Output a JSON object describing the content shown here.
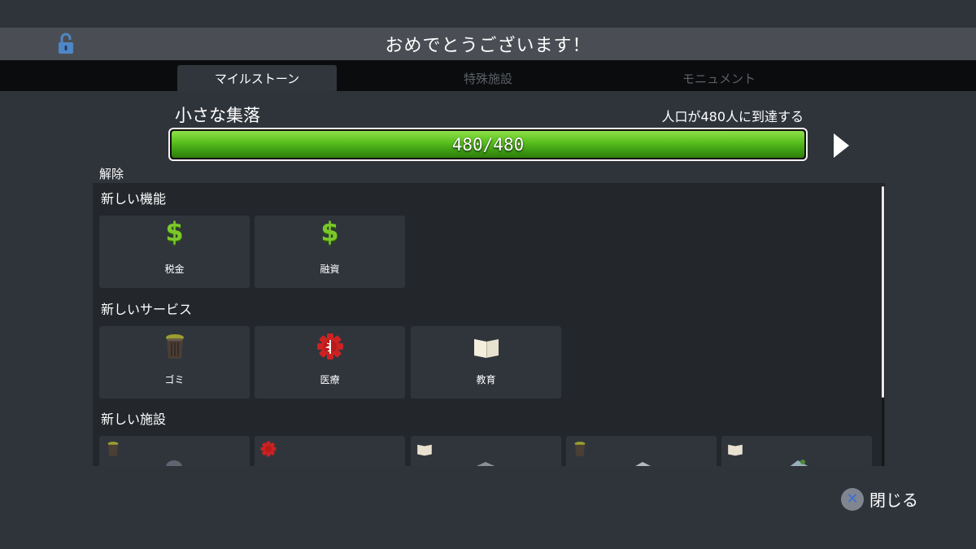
{
  "header": {
    "title": "おめでとうございます！",
    "lock_icon": "unlocked-padlock-icon"
  },
  "tabs": [
    {
      "label": "マイルストーン",
      "active": true
    },
    {
      "label": "特殊施設",
      "active": false
    },
    {
      "label": "モニュメント",
      "active": false
    }
  ],
  "milestone": {
    "name": "小さな集落",
    "goal": "人口が480人に到達する",
    "progress_text": "480/480",
    "progress_fraction": 1.0
  },
  "unlocks": {
    "label": "解除",
    "features": {
      "title": "新しい機能",
      "items": [
        {
          "label": "税金",
          "icon": "dollar-icon"
        },
        {
          "label": "融資",
          "icon": "dollar-icon"
        }
      ]
    },
    "services": {
      "title": "新しいサービス",
      "items": [
        {
          "label": "ゴミ",
          "icon": "trash-can-icon"
        },
        {
          "label": "医療",
          "icon": "medical-icon"
        },
        {
          "label": "教育",
          "icon": "book-icon"
        }
      ]
    },
    "buildings": {
      "title": "新しい施設",
      "items": [
        {
          "icon": "trash-can-icon"
        },
        {
          "icon": "medical-icon"
        },
        {
          "icon": "book-icon"
        },
        {
          "icon": "trash-can-icon"
        },
        {
          "icon": "book-icon"
        }
      ]
    }
  },
  "footer": {
    "close_label": "閉じる",
    "close_button_icon": "x-button-icon"
  },
  "colors": {
    "progress_green": "#5cc21f",
    "dollar_green": "#7bc82a",
    "medical_red": "#cc2222"
  }
}
